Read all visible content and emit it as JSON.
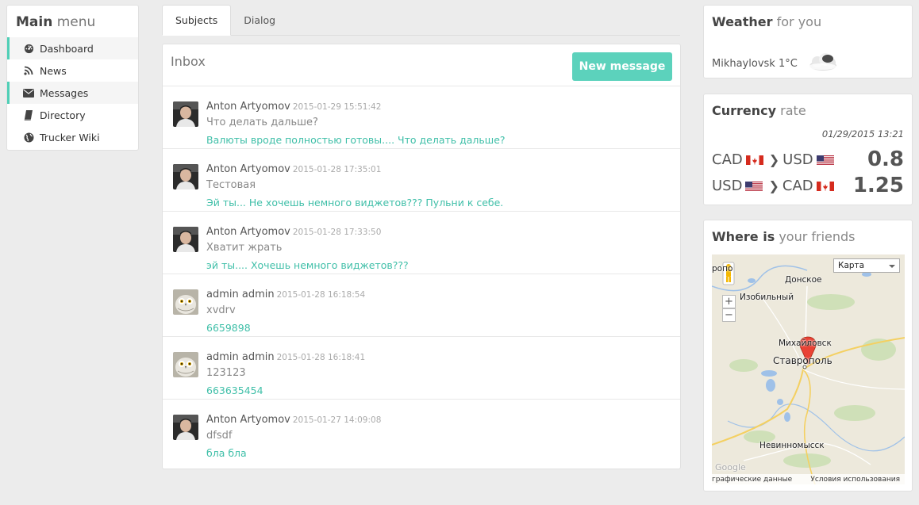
{
  "sidebar": {
    "title_bold": "Main",
    "title_light": "menu",
    "items": [
      {
        "label": "Dashboard",
        "icon": "dashboard-icon"
      },
      {
        "label": "News",
        "icon": "rss-icon"
      },
      {
        "label": "Messages",
        "icon": "envelope-icon"
      },
      {
        "label": "Directory",
        "icon": "book-icon"
      },
      {
        "label": "Trucker Wiki",
        "icon": "globe-icon"
      }
    ]
  },
  "tabs": [
    {
      "label": "Subjects"
    },
    {
      "label": "Dialog"
    }
  ],
  "inbox": {
    "title": "Inbox",
    "new_message_label": "New message",
    "messages": [
      {
        "author": "Anton Artyomov",
        "date": "2015-01-29 15:51:42",
        "subject": "Что делать дальше?",
        "preview": "Валюты вроде полностью готовы.... Что делать дальше?",
        "avatar": "person"
      },
      {
        "author": "Anton Artyomov",
        "date": "2015-01-28 17:35:01",
        "subject": "Тестовая",
        "preview": "Эй ты... Не хочешь немного виджетов??? Пульни к себе.",
        "avatar": "person"
      },
      {
        "author": "Anton Artyomov",
        "date": "2015-01-28 17:33:50",
        "subject": "Хватит жрать",
        "preview": "эй ты.... Хочешь немного виджетов???",
        "avatar": "person"
      },
      {
        "author": "admin admin",
        "date": "2015-01-28 16:18:54",
        "subject": "xvdrv",
        "preview": "6659898",
        "avatar": "owl"
      },
      {
        "author": "admin admin",
        "date": "2015-01-28 16:18:41",
        "subject": "123123",
        "preview": "663635454",
        "avatar": "owl"
      },
      {
        "author": "Anton Artyomov",
        "date": "2015-01-27 14:09:08",
        "subject": "dfsdf",
        "preview": "бла бла",
        "avatar": "person"
      }
    ]
  },
  "weather": {
    "title_bold": "Weather",
    "title_light": "for you",
    "location": "Mikhaylovsk",
    "temperature": "1°C",
    "icon": "cloud-icon"
  },
  "currency": {
    "title_bold": "Currency",
    "title_light": "rate",
    "date": "01/29/2015 13:21",
    "rates": [
      {
        "from": "CAD",
        "to": "USD",
        "value": "0.8"
      },
      {
        "from": "USD",
        "to": "CAD",
        "value": "1.25"
      }
    ]
  },
  "friends": {
    "title_bold": "Where is",
    "title_light": "your friends",
    "map": {
      "type_select": "Карта",
      "zoom_in": "+",
      "zoom_out": "−",
      "labels": [
        "ропо",
        "Донское",
        "Изобильный",
        "Михайловск",
        "Ставрополь",
        "Невинномысск"
      ],
      "footer_left": "графические данные",
      "footer_right": "Условия использования",
      "google": "Google"
    }
  }
}
